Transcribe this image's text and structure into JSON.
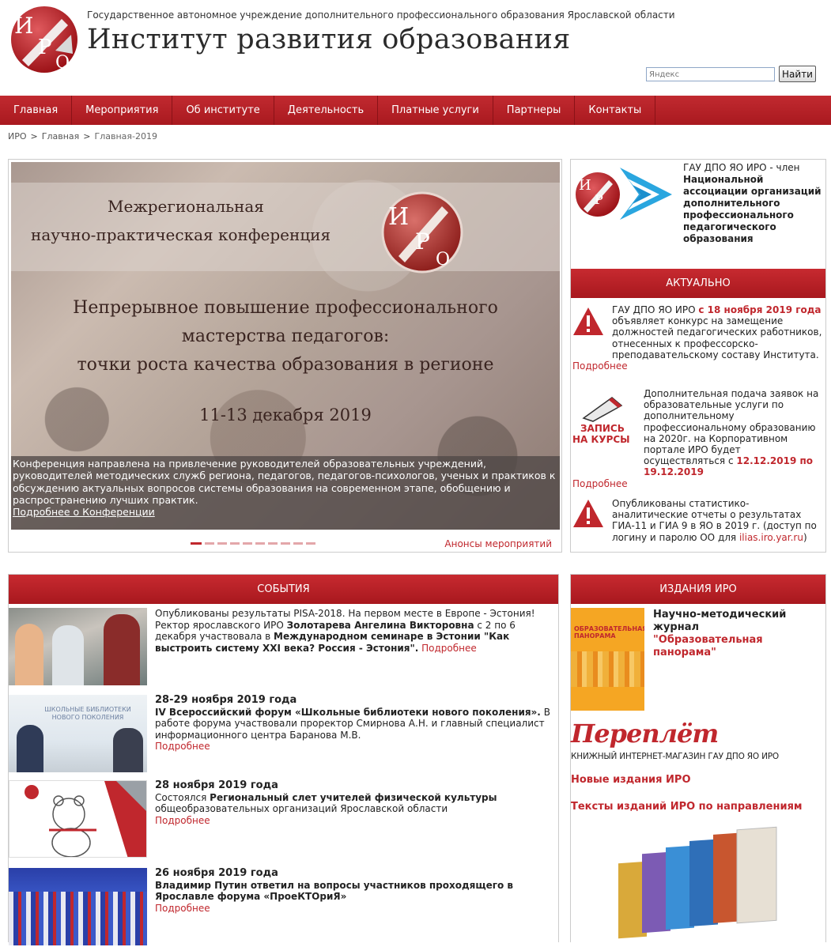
{
  "header": {
    "org_full": "Государственное автономное учреждение дополнительного профессионального образования Ярославской области",
    "title": "Институт развития образования",
    "logo_letters": "ИРО"
  },
  "search": {
    "placeholder": "Яндекс",
    "button": "Найти"
  },
  "nav": {
    "items": [
      {
        "label": "Главная"
      },
      {
        "label": "Мероприятия"
      },
      {
        "label": "Об институте"
      },
      {
        "label": "Деятельность"
      },
      {
        "label": "Платные услуги"
      },
      {
        "label": "Партнеры"
      },
      {
        "label": "Контакты"
      }
    ]
  },
  "breadcrumb": [
    "ИРО",
    "Главная",
    "Главная-2019"
  ],
  "slider": {
    "heading1": "Межрегиональная",
    "heading2": "научно-практическая конференция",
    "topic1": "Непрерывное повышение профессионального",
    "topic2": "мастерства педагогов:",
    "topic3": "точки роста качества образования в регионе",
    "date": "11-13 декабря 2019",
    "caption": "Конференция направлена на привлечение руководителей образовательных учреждений, руководителей методических служб региона, педагогов, педагогов-психологов, ученых и практиков к обсуждению актуальных вопросов системы образования на современном этапе, обобщению и распространению лучших практик.",
    "caption_link": "Подробнее о Конференции",
    "announce_link": "Анонсы мероприятий",
    "dot_count": 10,
    "active_dot": 1
  },
  "association": {
    "prefix": "ГАУ ДПО ЯО ИРО - член",
    "name": "Национальной ассоциации организаций дополнительного профессионального педагогического образования"
  },
  "aktual": {
    "title": "Актуально",
    "item1": {
      "pre": "ГАУ ДПО ЯО ИРО ",
      "highlight": "с 18 ноября 2019 года",
      "post": " объявляет конкурс на замещение должностей педагогических работников, отнесенных к профессорско-преподавательскому составу Института.",
      "more": "Подробнее"
    },
    "item2": {
      "img_line1": "ЗАПИСЬ",
      "img_line2": "НА КУРСЫ",
      "pre": "Дополнительная подача заявок на образовательные услуги по дополнительному профессиональному образованию на 2020г. на Корпоративном портале ИРО будет осуществляться с ",
      "highlight": "12.12.2019 по 19.12.2019",
      "more": "Подробнее"
    },
    "item3": {
      "pre": "Опубликованы статистико-аналитические отчеты о результатах ГИА-11 и ГИА 9 в ЯО в 2019 г. (доступ по логину и паролю ОО для ",
      "link": "ilias.iro.yar.ru",
      "post": ")"
    }
  },
  "events": {
    "title": "События",
    "items": [
      {
        "date": "",
        "t1": "Опубликованы результаты PISA-2018. На первом месте в Европе - Эстония! Ректор ярославского ИРО ",
        "b1": "Золотарева Ангелина Викторовна",
        "t2": " с 2 по 6 декабря участвовала в ",
        "b2": "Международном семинаре в Эстонии \"Как выстроить систему XXI века? Россия - Эстония\".",
        "more": " Подробнее"
      },
      {
        "date": "28-29 ноября 2019 года",
        "t1": "",
        "b1": "IV Всероссийский форум «Школьные библиотеки нового поколения».",
        "t2": " В работе форума участвовали проректор Смирнова А.Н. и главный специалист информационного центра Баранова М.В.",
        "b2": "",
        "more": "Подробнее"
      },
      {
        "date": "28 ноября 2019 года",
        "t1": "Состоялся ",
        "b1": "Региональный слет учителей физической культуры",
        "t2": " общеобразовательных организаций Ярославской области",
        "b2": "",
        "more": "Подробнее"
      },
      {
        "date": "26 ноября 2019 года",
        "t1": "",
        "b1": "Владимир Путин ответил на вопросы участников проходящего в Ярославле форума «ПроеКТОриЯ»",
        "t2": "",
        "b2": "",
        "more": "Подробнее"
      }
    ]
  },
  "publications": {
    "title": "Издания ИРО",
    "journal_pre": "Научно-методический журнал",
    "journal_name": "\"Образовательная панорама\"",
    "journal_cover_title": "ОБРАЗОВАТЕЛЬНАЯ ПАНОРАМА",
    "pereplet": "Переплёт",
    "pereplet_sub": "КНИЖНЫЙ ИНТЕРНЕТ-МАГАЗИН ГАУ ДПО ЯО ИРО",
    "new_link": "Новые издания ИРО",
    "texts_link": "Тексты изданий ИРО по направлениям"
  },
  "colors": {
    "brand": "#c0272d",
    "nav_bg": "#b3202a"
  }
}
